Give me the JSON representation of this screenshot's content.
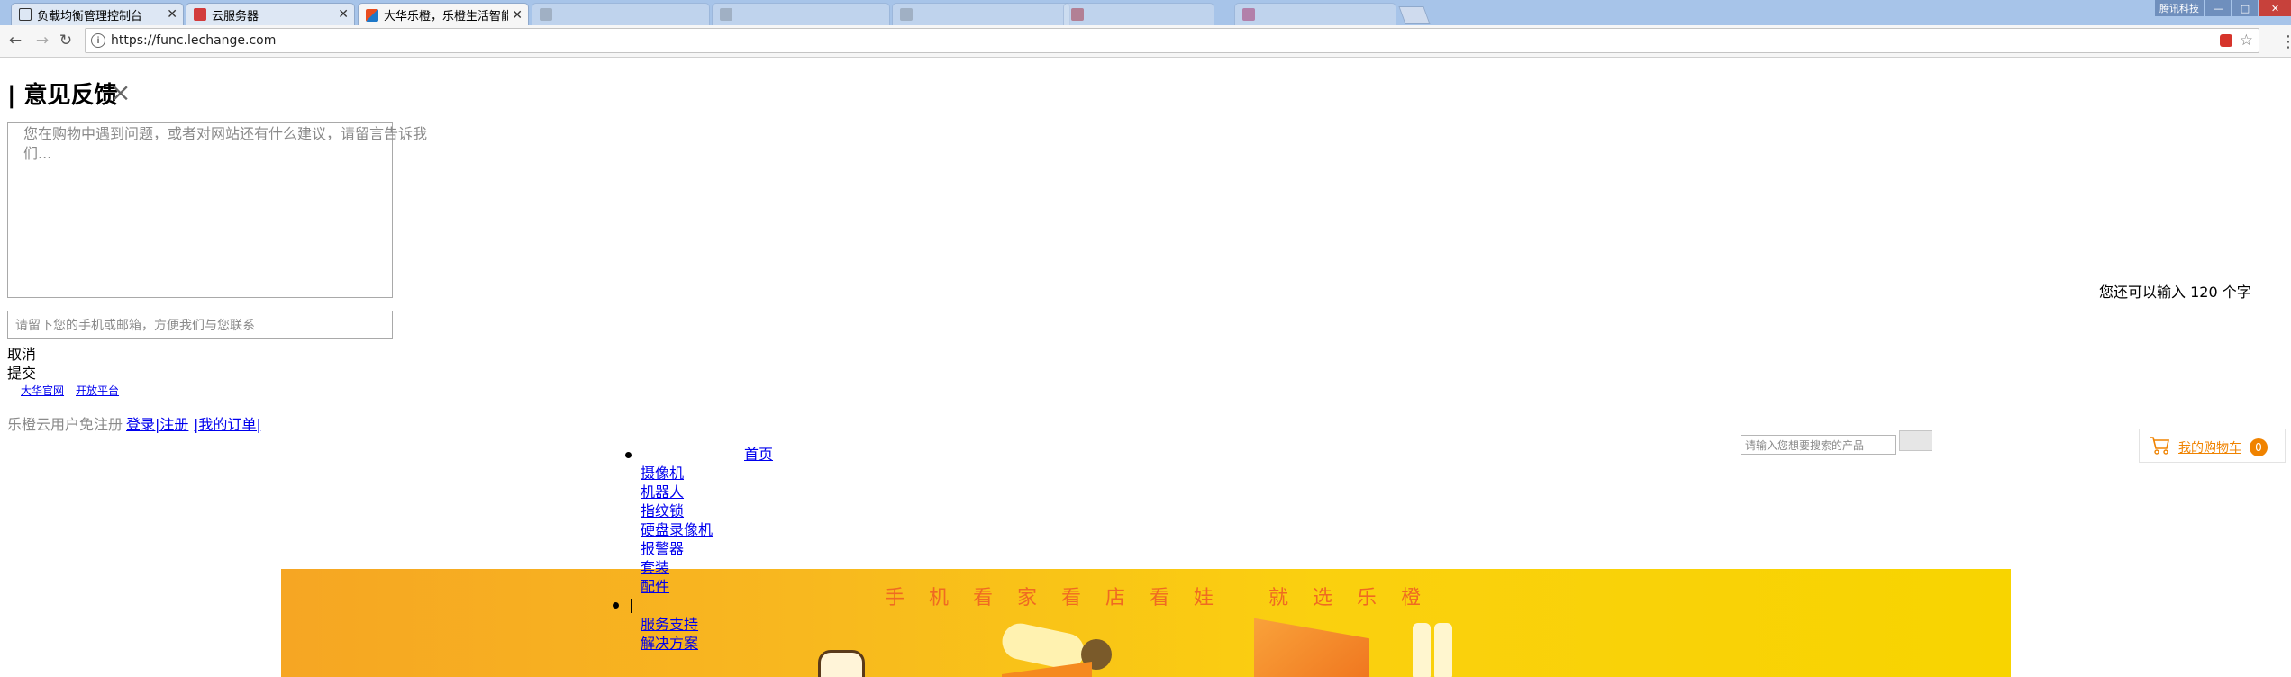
{
  "browser": {
    "tabs": [
      {
        "label": "负载均衡管理控制台",
        "state": "normal"
      },
      {
        "label": "云服务器",
        "state": "normal"
      },
      {
        "label": "大华乐橙，乐橙生活智能",
        "state": "active"
      },
      {
        "label": "",
        "state": "faded"
      },
      {
        "label": "",
        "state": "faded"
      },
      {
        "label": "",
        "state": "faded"
      },
      {
        "label": "",
        "state": "faded"
      },
      {
        "label": "",
        "state": "faded"
      }
    ],
    "window_user": "腾讯科技",
    "url": "https://func.lechange.com",
    "icons": {
      "back": "back-arrow-icon",
      "forward": "forward-arrow-icon",
      "reload": "reload-icon",
      "info": "info-icon",
      "star": "star-icon",
      "menu": "kebab-menu-icon"
    }
  },
  "feedback": {
    "title": "| 意见反馈",
    "close_glyph": "×",
    "textarea_placeholder": "您在购物中遇到问题，或者对网站还有什么建议，请留言告诉我们...",
    "char_counter": "您还可以输入 120 个字",
    "contact_placeholder": "请留下您的手机或邮箱，方便我们与您联系",
    "cancel_label": "取消",
    "submit_label": "提交"
  },
  "site": {
    "top_links": [
      "大华官网",
      "开放平台"
    ],
    "login_prompt": "乐橙云用户免注册",
    "login_link": "登录|注册",
    "orders_link": "|我的订单|",
    "search_placeholder": "请输入您想要搜索的产品",
    "cart_label": "我的购物车",
    "cart_count": "0",
    "nav": {
      "home": "首页",
      "items": [
        "摄像机",
        "机器人",
        "指纹锁",
        "硬盘录像机",
        "报警器",
        "套装",
        "配件"
      ],
      "separator": "|",
      "items2": [
        "服务支持",
        "解决方案"
      ]
    }
  },
  "banner": {
    "slogan": "手机看家看店看娃  就选乐橙",
    "colors": {
      "start": "#f6a623",
      "end": "#f8d400",
      "text": "#ef6a22"
    }
  }
}
